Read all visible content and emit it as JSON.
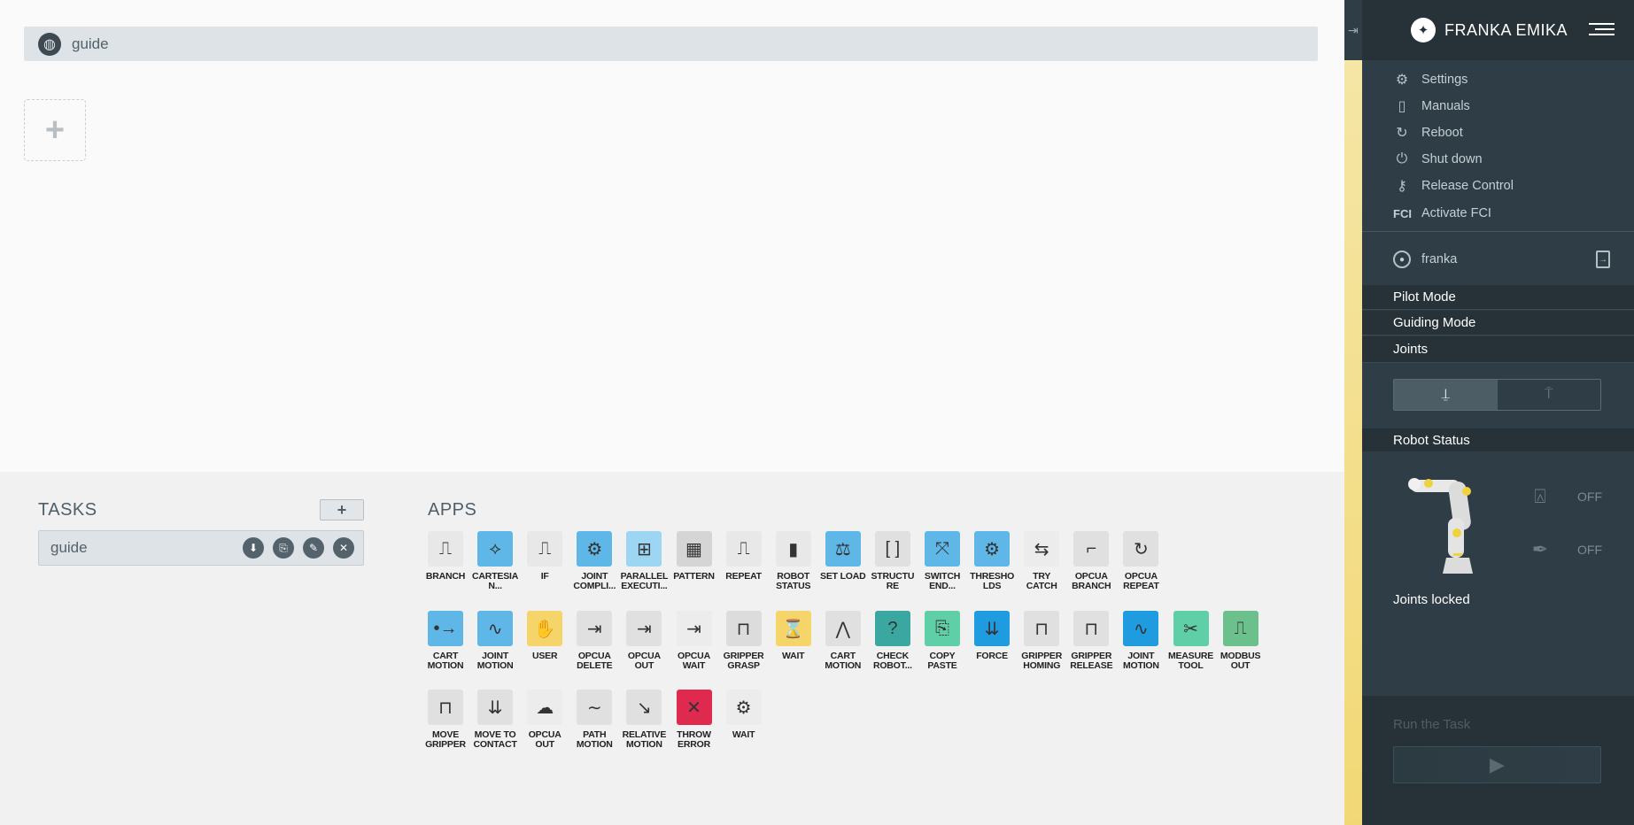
{
  "task_header": {
    "title": "guide",
    "icon": "globe-icon"
  },
  "add_slot": {
    "symbol": "+"
  },
  "tasks": {
    "title": "TASKS",
    "add_label": "+",
    "items": [
      {
        "name": "guide"
      }
    ]
  },
  "apps": {
    "title": "APPS",
    "items": [
      {
        "label": "BRANCH",
        "icon": "branch-icon",
        "color": "#e8e8e8",
        "glyph": "⎍"
      },
      {
        "label": "CARTESIA\nN...",
        "icon": "cartesian-icon",
        "color": "#5fb7e8",
        "glyph": "⟡"
      },
      {
        "label": "IF",
        "icon": "if-icon",
        "color": "#e8e8e8",
        "glyph": "⎍"
      },
      {
        "label": "JOINT\nCOMPLI...",
        "icon": "joint-compliance-icon",
        "color": "#5fb7e8",
        "glyph": "⚙"
      },
      {
        "label": "PARALLEL\nEXECUTI...",
        "icon": "parallel-execution-icon",
        "color": "#9dd6f2",
        "glyph": "⊞"
      },
      {
        "label": "PATTERN",
        "icon": "pattern-icon",
        "color": "#d5d5d5",
        "glyph": "▦"
      },
      {
        "label": "REPEAT",
        "icon": "repeat-icon",
        "color": "#e8e8e8",
        "glyph": "⎍"
      },
      {
        "label": "ROBOT\nSTATUS",
        "icon": "robot-status-icon",
        "color": "#e8e8e8",
        "glyph": "▮"
      },
      {
        "label": "SET LOAD",
        "icon": "set-load-icon",
        "color": "#5fb7e8",
        "glyph": "⚖"
      },
      {
        "label": "STRUCTU\nRE",
        "icon": "structure-icon",
        "color": "#e0e0e0",
        "glyph": "[ ]"
      },
      {
        "label": "SWITCH\nEND...",
        "icon": "switch-end-effector-icon",
        "color": "#5fb7e8",
        "glyph": "⤧"
      },
      {
        "label": "THRESHO\nLDS",
        "icon": "thresholds-icon",
        "color": "#5fb7e8",
        "glyph": "⚙"
      },
      {
        "label": "TRY\nCATCH",
        "icon": "try-catch-icon",
        "color": "#ececec",
        "glyph": "⇆"
      },
      {
        "label": "OPCUA\nBRANCH",
        "icon": "opcua-branch-icon",
        "color": "#e0e0e0",
        "glyph": "⌐"
      },
      {
        "label": "OPCUA\nREPEAT",
        "icon": "opcua-repeat-icon",
        "color": "#e0e0e0",
        "glyph": "↻"
      },
      {
        "label": "CART\nMOTION",
        "icon": "cart-motion-icon",
        "color": "#5fb7e8",
        "glyph": "•→"
      },
      {
        "label": "JOINT\nMOTION",
        "icon": "joint-motion-icon",
        "color": "#5fb7e8",
        "glyph": "∿"
      },
      {
        "label": "USER",
        "icon": "user-icon",
        "color": "#f5d46a",
        "glyph": "✋"
      },
      {
        "label": "OPCUA\nDELETE",
        "icon": "opcua-delete-icon",
        "color": "#e0e0e0",
        "glyph": "⇥"
      },
      {
        "label": "OPCUA\nOUT",
        "icon": "opcua-out-icon",
        "color": "#e0e0e0",
        "glyph": "⇥"
      },
      {
        "label": "OPCUA\nWAIT",
        "icon": "opcua-wait-icon",
        "color": "#ececec",
        "glyph": "⇥"
      },
      {
        "label": "GRIPPER\nGRASP",
        "icon": "gripper-grasp-icon",
        "color": "#dcdcdc",
        "glyph": "⊓"
      },
      {
        "label": "WAIT",
        "icon": "hourglass-icon",
        "color": "#f5d46a",
        "glyph": "⌛"
      },
      {
        "label": "CART\nMOTION",
        "icon": "cart-motion-gray-icon",
        "color": "#e0e0e0",
        "glyph": "⋀"
      },
      {
        "label": "CHECK\nROBOT...",
        "icon": "check-robot-icon",
        "color": "#3aa7a0",
        "glyph": "?"
      },
      {
        "label": "COPY\nPASTE",
        "icon": "copy-paste-icon",
        "color": "#5fcfa8",
        "glyph": "⎘"
      },
      {
        "label": "FORCE",
        "icon": "force-icon",
        "color": "#1f9be0",
        "glyph": "⇊"
      },
      {
        "label": "GRIPPER\nHOMING",
        "icon": "gripper-homing-icon",
        "color": "#e0e0e0",
        "glyph": "⊓"
      },
      {
        "label": "GRIPPER\nRELEASE",
        "icon": "gripper-release-icon",
        "color": "#e0e0e0",
        "glyph": "⊓"
      },
      {
        "label": "JOINT\nMOTION",
        "icon": "joint-motion-wave-icon",
        "color": "#1f9be0",
        "glyph": "∿"
      },
      {
        "label": "MEASURE\nTOOL",
        "icon": "measure-tool-icon",
        "color": "#5fcfa8",
        "glyph": "✂"
      },
      {
        "label": "MODBUS\nOUT",
        "icon": "modbus-out-icon",
        "color": "#6cc08c",
        "glyph": "⎍"
      },
      {
        "label": "MOVE\nGRIPPER",
        "icon": "move-gripper-icon",
        "color": "#e0e0e0",
        "glyph": "⊓"
      },
      {
        "label": "MOVE TO\nCONTACT",
        "icon": "move-to-contact-icon",
        "color": "#e0e0e0",
        "glyph": "⇊"
      },
      {
        "label": "OPCUA\nOUT",
        "icon": "opcua-out-cloud-icon",
        "color": "#ececec",
        "glyph": "☁"
      },
      {
        "label": "PATH\nMOTION",
        "icon": "path-motion-icon",
        "color": "#e0e0e0",
        "glyph": "∼"
      },
      {
        "label": "RELATIVE\nMOTION",
        "icon": "relative-motion-icon",
        "color": "#e0e0e0",
        "glyph": "↘"
      },
      {
        "label": "THROW\nERROR",
        "icon": "throw-error-icon",
        "color": "#e0294f",
        "glyph": "✕"
      },
      {
        "label": "WAIT",
        "icon": "wait-gear-icon",
        "color": "#ececec",
        "glyph": "⚙"
      }
    ]
  },
  "sidebar": {
    "collapse_glyph": "⇥",
    "brand": "FRANKA EMIKA",
    "menu": [
      {
        "label": "Settings",
        "icon": "gear-icon",
        "glyph": "⚙"
      },
      {
        "label": "Manuals",
        "icon": "book-icon",
        "glyph": "▯"
      },
      {
        "label": "Reboot",
        "icon": "reboot-icon",
        "glyph": "↻"
      },
      {
        "label": "Shut down",
        "icon": "power-icon",
        "glyph": "⏻"
      },
      {
        "label": "Release Control",
        "icon": "key-icon",
        "glyph": "⚷"
      },
      {
        "label": "Activate FCI",
        "icon": "fci-icon",
        "glyph": "FCI"
      }
    ],
    "user": "franka",
    "modes": [
      "Pilot Mode",
      "Guiding Mode",
      "Joints"
    ],
    "robot_status_title": "Robot Status",
    "end_effector_status": "OFF",
    "tool_status": "OFF",
    "joints_locked": "Joints locked",
    "run_title": "Run the Task"
  }
}
